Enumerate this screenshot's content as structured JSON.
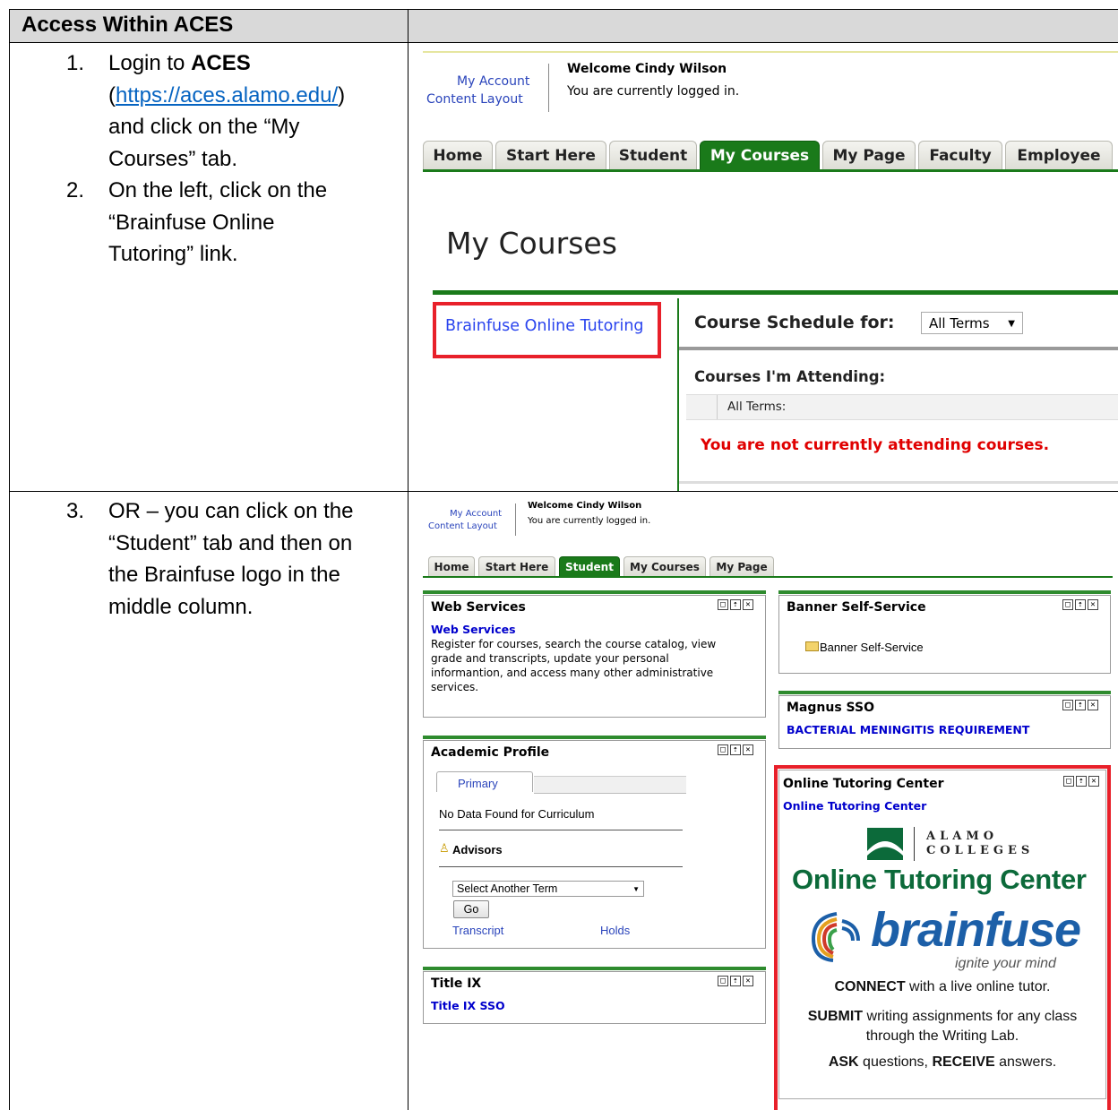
{
  "table": {
    "header_left": "Access Within ACES",
    "steps": [
      {
        "num": "1.",
        "pre": "Login to ",
        "bold": "ACES",
        "link_open": "(",
        "link": "https://aces.alamo.edu/",
        "link_close": ")",
        "rest_line1": "and click on the “My",
        "rest_line2": "Courses” tab."
      },
      {
        "num": "2.",
        "line1": "On the left, click on the",
        "line2": "“Brainfuse Online",
        "line3": "Tutoring” link."
      },
      {
        "num": "3.",
        "line1": "OR – you can click on the",
        "line2": "“Student” tab and then on",
        "line3": "the Brainfuse logo in the",
        "line4": "middle column."
      }
    ]
  },
  "shot1": {
    "my_account": "My Account",
    "content_layout": "Content Layout",
    "welcome": "Welcome Cindy Wilson",
    "logged_in": "You are currently logged in.",
    "tabs": [
      "Home",
      "Start Here",
      "Student",
      "My Courses",
      "My Page",
      "Faculty",
      "Employee"
    ],
    "active_tab": "My Courses",
    "page_title": "My Courses",
    "brainfuse_link": "Brainfuse Online Tutoring",
    "schedule_label": "Course Schedule for:",
    "terms_select": "All Terms",
    "attending_label": "Courses I'm Attending:",
    "all_terms_row": "All Terms:",
    "not_attending": "You are not currently attending courses."
  },
  "shot2": {
    "my_account": "My Account",
    "content_layout": "Content Layout",
    "welcome": "Welcome Cindy Wilson",
    "logged_in": "You are currently logged in.",
    "tabs": [
      "Home",
      "Start Here",
      "Student",
      "My Courses",
      "My Page"
    ],
    "active_tab": "Student",
    "web_services": {
      "title": "Web Services",
      "link": "Web Services",
      "desc1": "Register for courses, search the course catalog, view",
      "desc2": "grade and transcripts, update your personal",
      "desc3": "informantion, and access many other administrative",
      "desc4": "services."
    },
    "banner": {
      "title": "Banner Self-Service",
      "item": "Banner Self-Service"
    },
    "magnus": {
      "title": "Magnus SSO",
      "link": "BACTERIAL MENINGITIS REQUIREMENT"
    },
    "academic": {
      "title": "Academic Profile",
      "tab": "Primary",
      "no_data": "No Data Found for Curriculum",
      "advisors": "Advisors",
      "select": "Select Another Term",
      "go": "Go",
      "transcript": "Transcript",
      "holds": "Holds"
    },
    "title_ix": {
      "title": "Title IX",
      "link": "Title IX SSO"
    },
    "tutoring": {
      "title": "Online Tutoring Center",
      "link": "Online Tutoring Center",
      "alamo1": "ALAMO",
      "alamo2": "COLLEGES",
      "big_title": "Online Tutoring Center",
      "brand": "brainfuse",
      "tagline": "ignite your mind",
      "connect_b": "CONNECT",
      "connect_r": " with a live online tutor.",
      "submit_b": "SUBMIT",
      "submit_r": " writing assignments for any class",
      "submit_r2": "through the Writing Lab.",
      "ask_b": "ASK",
      "ask_m": " questions, ",
      "receive_b": "RECEIVE",
      "receive_r": " answers."
    }
  },
  "colors": {
    "green": "#1a7a1a",
    "highlight_red": "#e8202a",
    "link_blue": "#0000cc",
    "brand_blue": "#1c5fa8",
    "brand_green": "#0c6a3a"
  }
}
